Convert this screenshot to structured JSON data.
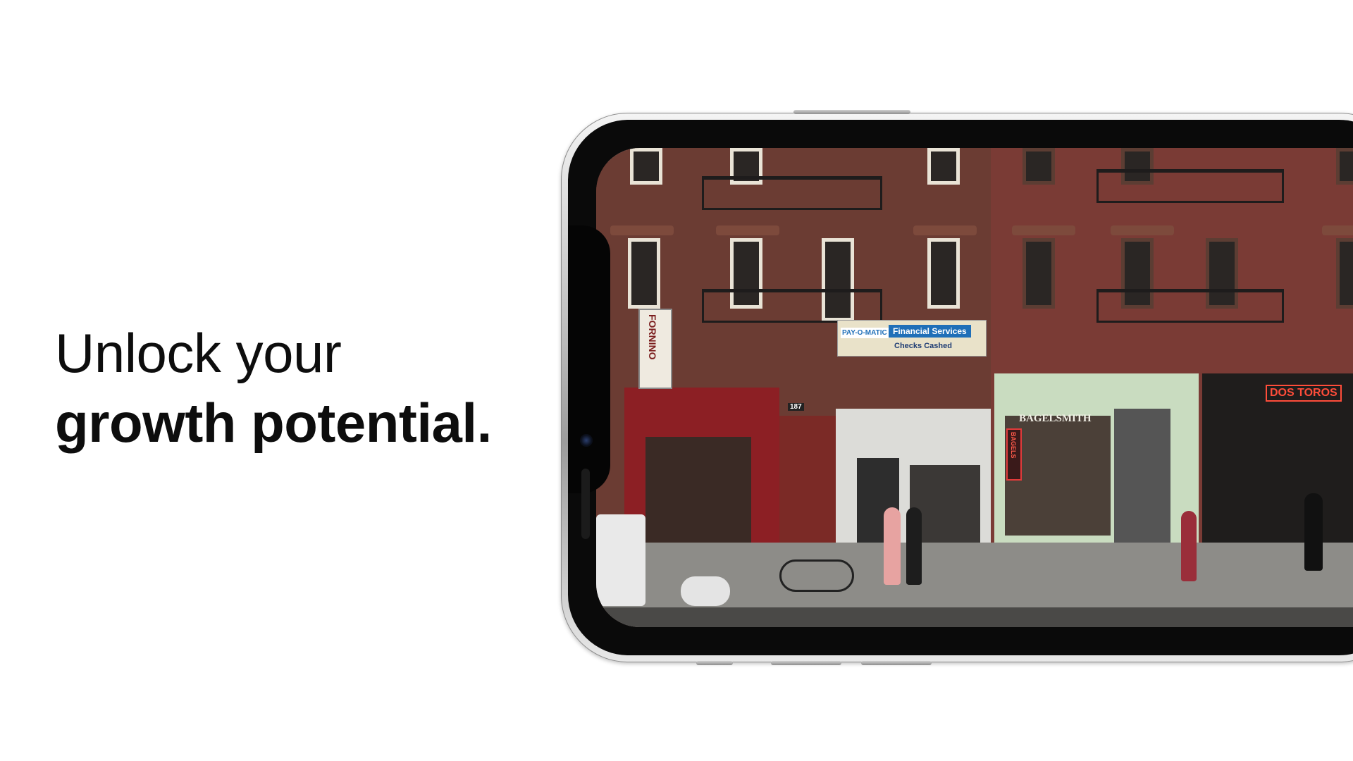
{
  "headline": {
    "line1": "Unlock your",
    "line2": "growth potential."
  },
  "phone": {
    "screen_image": "Brooklyn street storefronts photo",
    "storefront_signs": {
      "payomatic": "PAY-O-MATIC",
      "financial": "Financial Services",
      "checks": "Checks Cashed",
      "bagelsmith": "BAGELSMITH",
      "bagels_neon": "BAGELS",
      "dos_toros": "DOS TOROS",
      "fornino": "FORNINO",
      "building_number": "187"
    }
  },
  "colors": {
    "background": "#ffffff",
    "text": "#0d0d0d",
    "brick": "#6a3a32",
    "storefront_green": "#c9dcc0",
    "financial_blue": "#1f6fb8"
  }
}
